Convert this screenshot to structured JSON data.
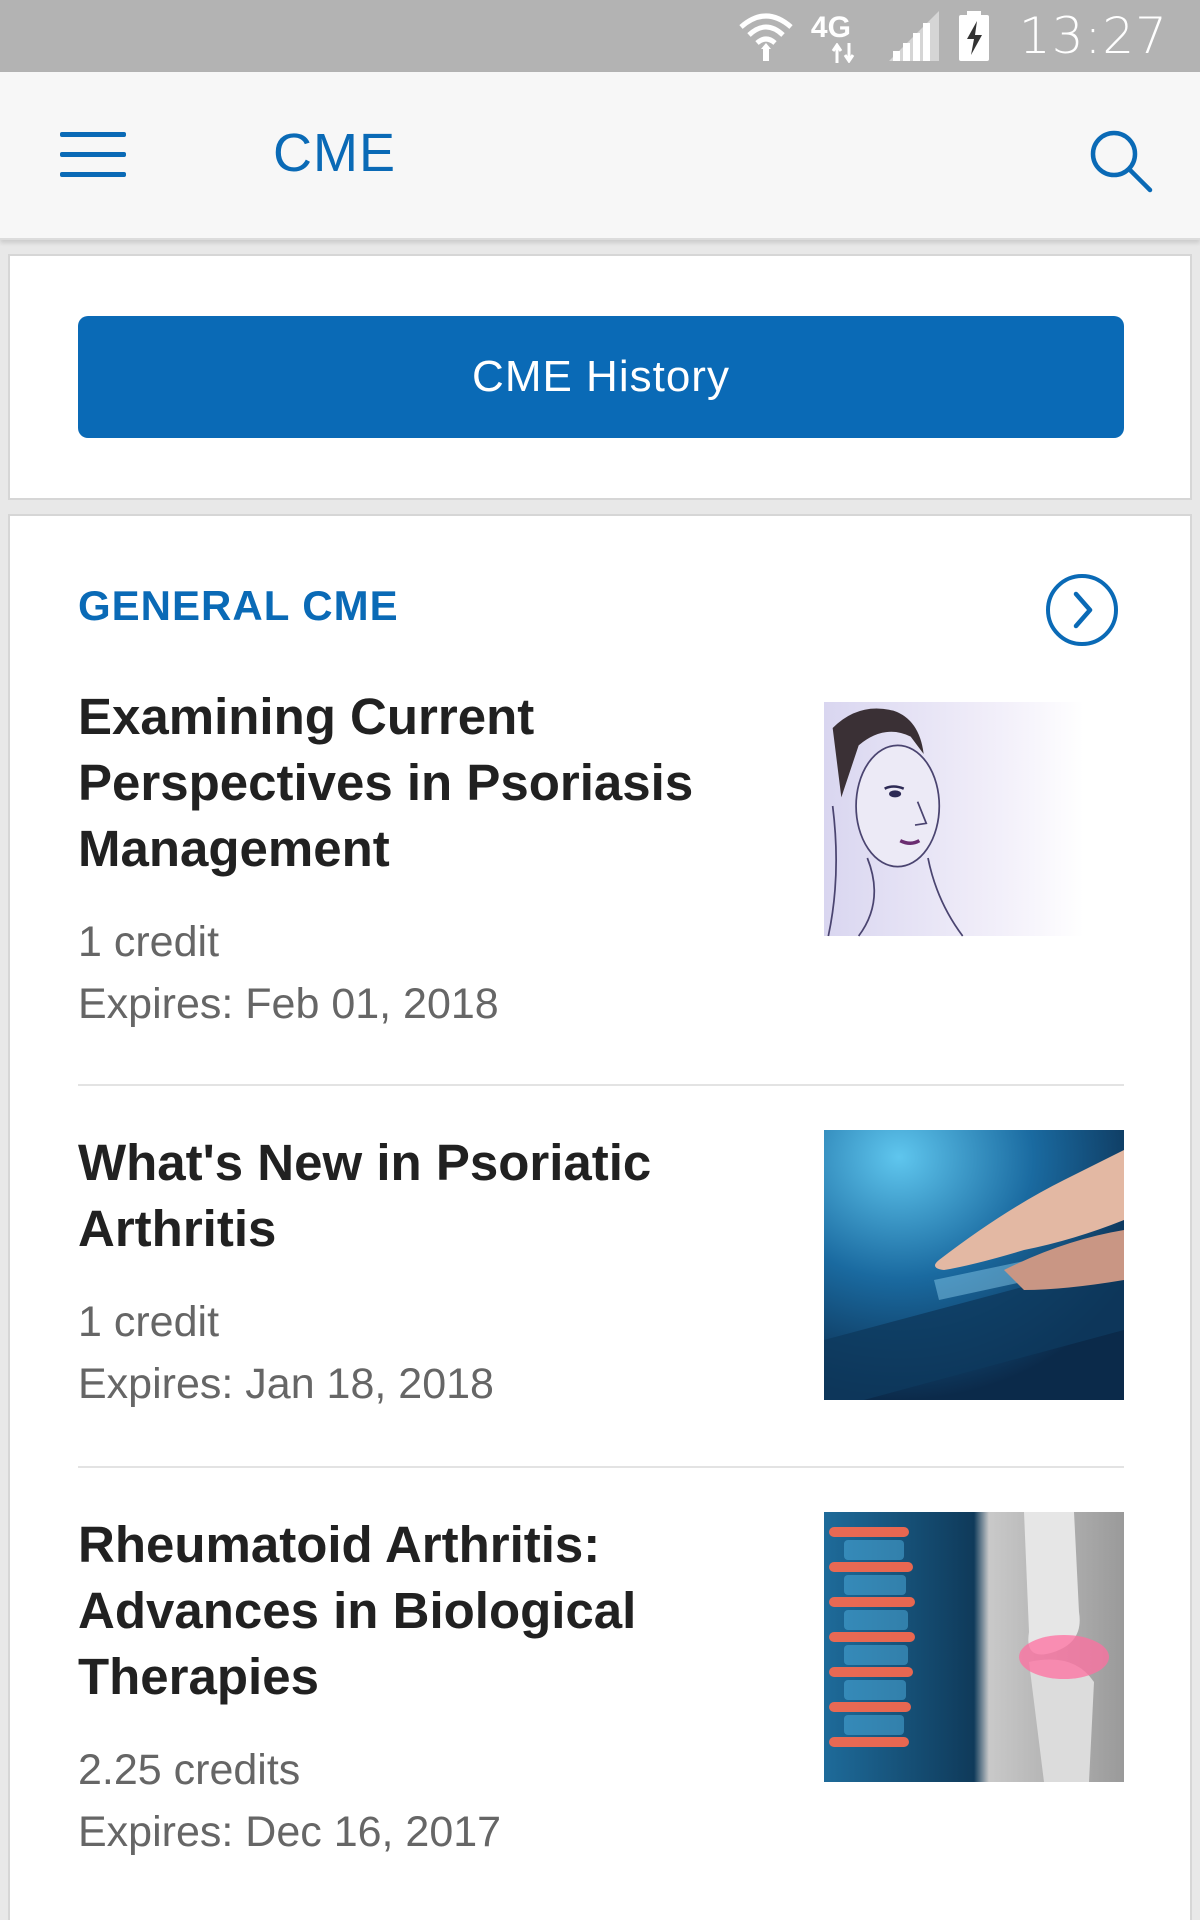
{
  "status_bar": {
    "time": "13:27",
    "network": "4G",
    "icons": [
      "wifi-icon",
      "4g-icon",
      "signal-icon",
      "battery-charging-icon"
    ]
  },
  "app_bar": {
    "title": "CME",
    "icons": [
      "menu-icon",
      "search-icon"
    ]
  },
  "history_button": {
    "label": "CME History"
  },
  "section": {
    "title": "GENERAL CME",
    "icon": "chevron-right-circle-icon"
  },
  "articles": [
    {
      "title": "Examining Current Perspectives in Psoriasis Management",
      "credits": "1 credit",
      "expires": "Expires: Feb 01, 2018",
      "thumbnail": "sketch-woman-face-image"
    },
    {
      "title": "What's New in Psoriatic Arthritis",
      "credits": "1 credit",
      "expires": "Expires: Jan 18, 2018",
      "thumbnail": "finger-touching-tablet-image"
    },
    {
      "title": "Rheumatoid Arthritis: Advances in Biological Therapies",
      "credits": "2.25 credits",
      "expires": "Expires: Dec 16, 2017",
      "thumbnail": "spine-and-knee-xray-image"
    }
  ],
  "colors": {
    "accent": "#0a6ab6",
    "status_bar": "#b3b3b3",
    "title_text": "#212121",
    "meta_text": "#666666"
  }
}
